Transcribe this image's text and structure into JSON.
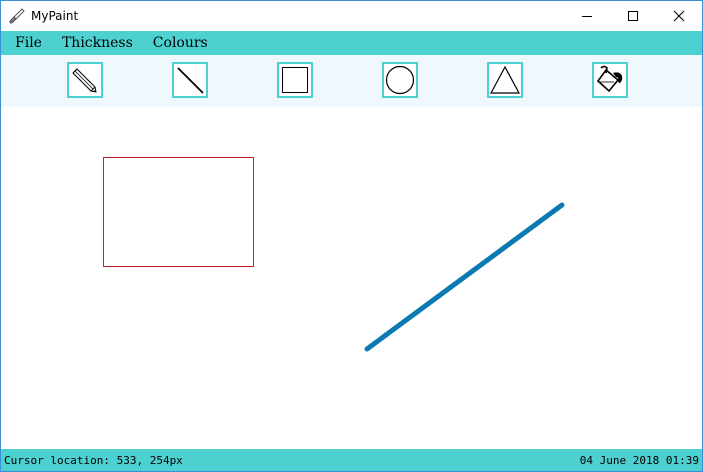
{
  "window": {
    "title": "MyPaint",
    "icons": {
      "app": "brush-icon",
      "minimize": "minimize-icon",
      "maximize": "maximize-icon",
      "close": "close-icon"
    }
  },
  "menu": {
    "items": [
      {
        "label": "File"
      },
      {
        "label": "Thickness"
      },
      {
        "label": "Colours"
      }
    ]
  },
  "toolbar": {
    "tools": [
      {
        "name": "pencil",
        "icon": "pencil-icon"
      },
      {
        "name": "line",
        "icon": "line-icon"
      },
      {
        "name": "rectangle",
        "icon": "rectangle-icon"
      },
      {
        "name": "circle",
        "icon": "circle-icon"
      },
      {
        "name": "triangle",
        "icon": "triangle-icon"
      },
      {
        "name": "fill",
        "icon": "paint-bucket-icon"
      }
    ]
  },
  "canvas": {
    "shapes": [
      {
        "type": "rectangle",
        "stroke": "#c8202a"
      },
      {
        "type": "line",
        "stroke": "#0a7ab0"
      }
    ]
  },
  "status": {
    "cursor_text": "Cursor location: 533, 254px",
    "datetime": "04 June 2018 01:39"
  },
  "colors": {
    "accent": "#4dd0d0",
    "toolbar_bg": "#eef8fd",
    "window_border": "#3c8fd6"
  }
}
